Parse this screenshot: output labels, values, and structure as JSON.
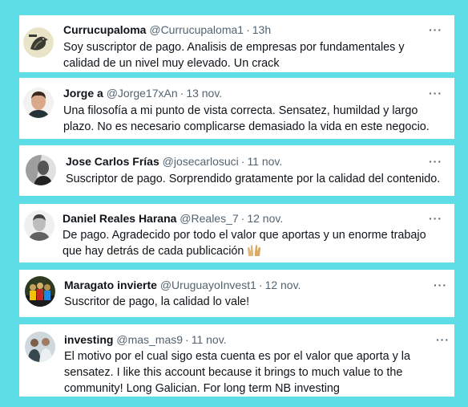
{
  "tweets": [
    {
      "name": "Currucupaloma",
      "handle": "@Currucupaloma1",
      "time": "13h",
      "text": "Soy suscriptor de pago. Analisis de empresas por fundamentales y calidad de un nivel muy elevado. Un crack",
      "avatar_icon": "bird-logo-icon"
    },
    {
      "name": "Jorge a",
      "handle": "@Jorge17xAn",
      "time": "13 nov.",
      "text": "Una filosofía a mi punto de vista correcta. Sensatez, humildad y largo plazo. No es necesario complicarse demasiado la vida en este negocio.",
      "avatar_icon": "person-photo-icon"
    },
    {
      "name": "Jose Carlos Frías",
      "handle": "@josecarlosuci",
      "time": "11 nov.",
      "text": "Suscriptor de pago. Sorprendido gratamente por la calidad del contenido.",
      "avatar_icon": "person-photo-icon"
    },
    {
      "name": "Daniel Reales Harana",
      "handle": "@Reales_7",
      "time": "12 nov.",
      "text": "De pago. Agradecido por todo el valor que aportas y un enorme trabajo que hay detrás de cada publicación",
      "emoji": "raising-hands-icon",
      "avatar_icon": "person-photo-icon"
    },
    {
      "name": "Maragato invierte",
      "handle": "@UruguayoInvest1",
      "time": "12 nov.",
      "text": "Suscritor de pago, la calidad lo vale!",
      "avatar_icon": "group-photo-icon"
    },
    {
      "name": "investing",
      "handle": "@mas_mas9",
      "time": "11 nov.",
      "text": "El motivo por el cual sigo esta cuenta es por el valor que aporta y la sensatez. I like this account because it brings to much value to the community! Long Galician. For long term NB investing",
      "avatar_icon": "person-photo-icon"
    }
  ],
  "more_label": "···"
}
